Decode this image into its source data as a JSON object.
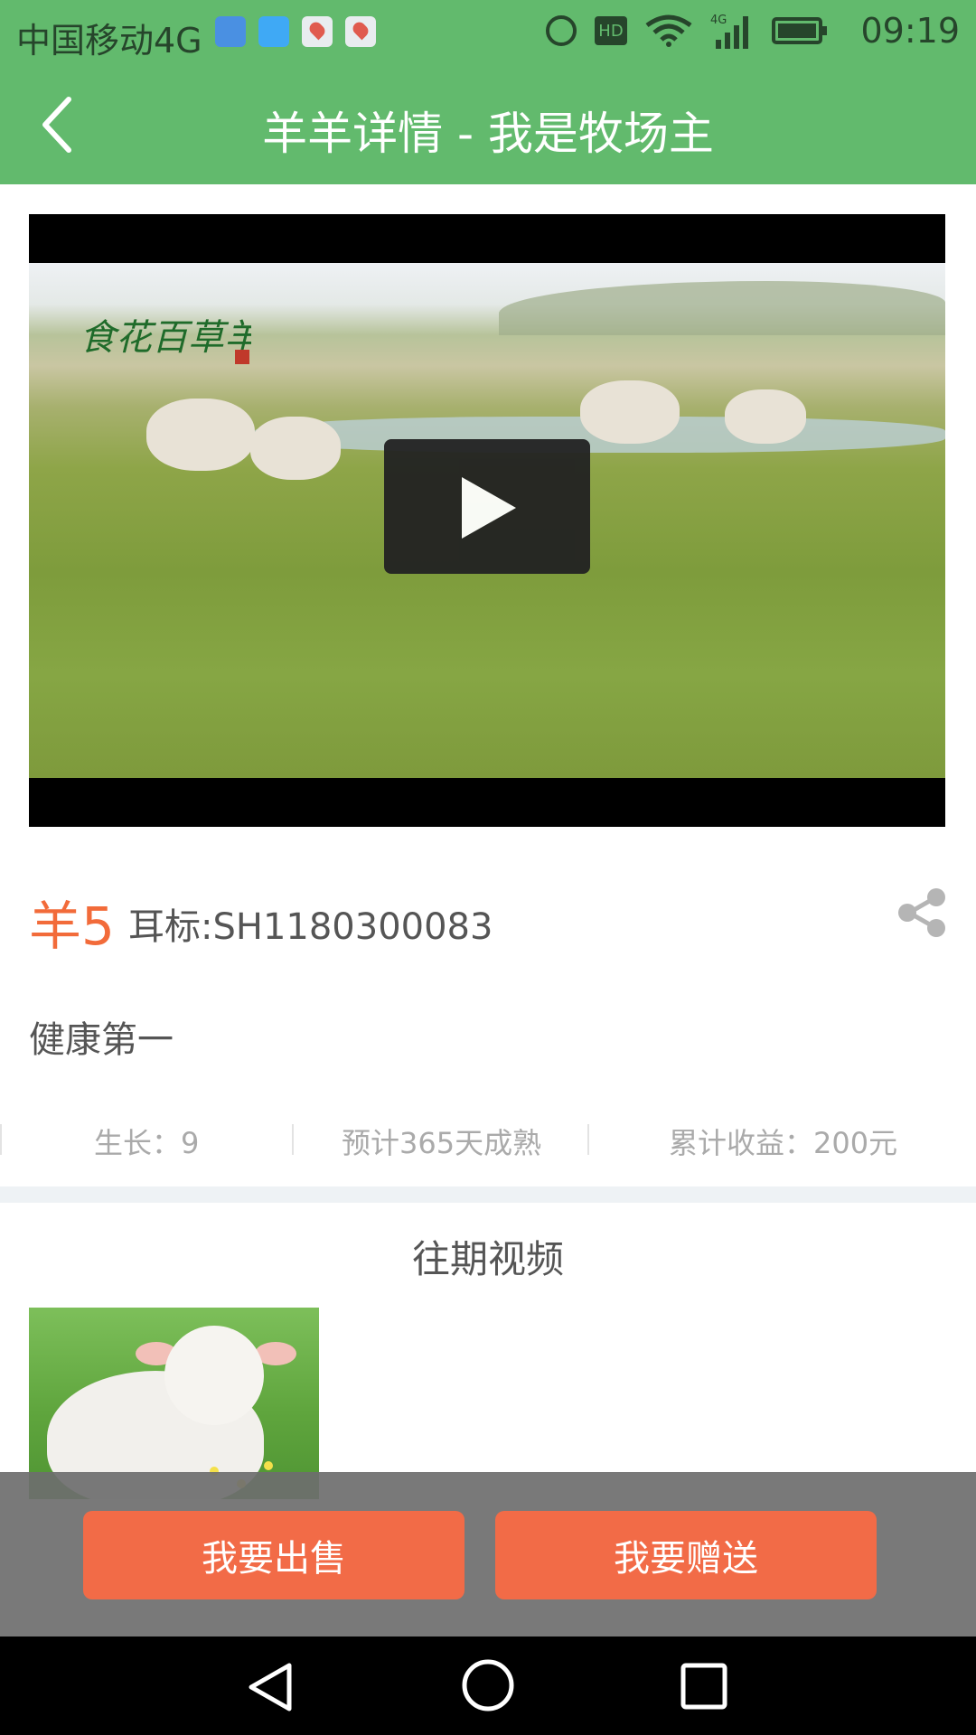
{
  "status_bar": {
    "carrier": "中国移动4G",
    "hd_label": "HD",
    "network": "4G",
    "time": "09:19"
  },
  "header": {
    "title": "羊羊详情 - 我是牧场主"
  },
  "video": {
    "brand_logo": "食花百草羊"
  },
  "sheep": {
    "name": "羊5",
    "ear_tag": "耳标:SH1180300083",
    "description": "健康第一"
  },
  "stats": {
    "growth": "生长：9",
    "maturity": "预计365天成熟",
    "income": "累计收益：200元"
  },
  "past_videos": {
    "title": "往期视频"
  },
  "actions": {
    "sell_label": "我要出售",
    "gift_label": "我要赠送"
  },
  "colors": {
    "header_green": "#62ba6d",
    "accent_orange": "#f26b47"
  }
}
